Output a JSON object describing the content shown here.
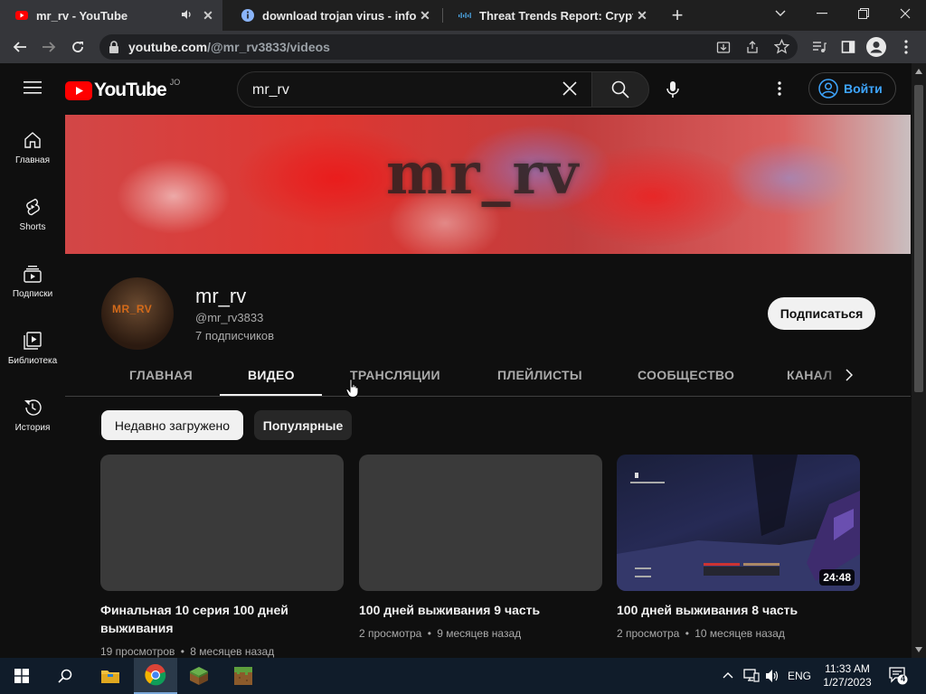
{
  "browser": {
    "tabs": [
      {
        "title": "mr_rv - YouTube",
        "active": true
      },
      {
        "title": "download trojan virus - info.c",
        "active": false
      },
      {
        "title": "Threat Trends Report: Crypto",
        "active": false
      }
    ],
    "url_host": "youtube.com",
    "url_path": "/@mr_rv3833/videos"
  },
  "youtube": {
    "logo_text": "YouTube",
    "region": "JO",
    "search_value": "mr_rv",
    "signin_label": "Войти"
  },
  "sidebar": {
    "items": [
      {
        "label": "Главная",
        "icon": "home-icon"
      },
      {
        "label": "Shorts",
        "icon": "shorts-icon"
      },
      {
        "label": "Подписки",
        "icon": "subscriptions-icon"
      },
      {
        "label": "Библиотека",
        "icon": "library-icon"
      },
      {
        "label": "История",
        "icon": "history-icon"
      }
    ]
  },
  "channel": {
    "banner_text": "mr_rv",
    "avatar_text": "MR_RV",
    "name": "mr_rv",
    "handle": "@mr_rv3833",
    "subscribers": "7 подписчиков",
    "subscribe_label": "Подписаться",
    "tabs": [
      "ГЛАВНАЯ",
      "ВИДЕО",
      "ТРАНСЛЯЦИИ",
      "ПЛЕЙЛИСТЫ",
      "СООБЩЕСТВО",
      "КАНАЛ"
    ],
    "active_tab": "ВИДЕО"
  },
  "chips": [
    {
      "label": "Недавно загружено",
      "selected": true
    },
    {
      "label": "Популярные",
      "selected": false
    }
  ],
  "videos": [
    {
      "title": "Финальная 10 серия 100 дней выживания",
      "views": "19 просмотров",
      "age": "8 месяцев назад",
      "duration": ""
    },
    {
      "title": "100 дней выживания 9 часть",
      "views": "2 просмотра",
      "age": "9 месяцев назад",
      "duration": ""
    },
    {
      "title": "100 дней выживания 8 часть",
      "views": "2 просмотра",
      "age": "10 месяцев назад",
      "duration": "24:48"
    }
  ],
  "meta_separator": "•",
  "taskbar": {
    "lang": "ENG",
    "time": "11:33 AM",
    "date": "1/27/2023",
    "notifications": "4"
  },
  "colors": {
    "bg": "#0f0f0f",
    "youtube_red": "#ff0000",
    "link_blue": "#3ea6ff",
    "taskbar": "#101c2a"
  }
}
